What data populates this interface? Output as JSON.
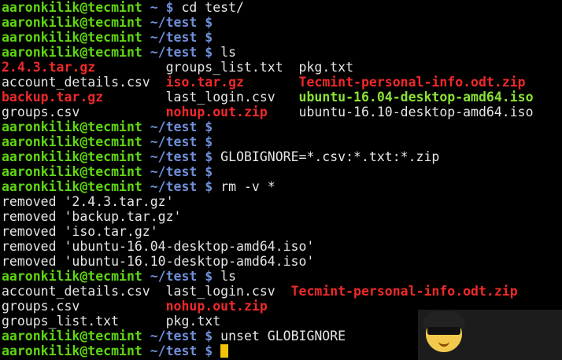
{
  "prompt": {
    "user": "aaronkilik@tecmint",
    "sep": " ",
    "dollar": " $"
  },
  "lines": [
    {
      "kind": "prompt",
      "path": "~",
      "cmd": "cd test/"
    },
    {
      "kind": "prompt",
      "path": "~/test",
      "cmd": ""
    },
    {
      "kind": "prompt",
      "path": "~/test",
      "cmd": ""
    },
    {
      "kind": "prompt",
      "path": "~/test",
      "cmd": "ls"
    },
    {
      "kind": "files",
      "cols": [
        {
          "name": "2.4.3.tar.gz",
          "style": "red"
        },
        {
          "name": "groups_list.txt",
          "style": "plain"
        },
        {
          "name": "pkg.txt",
          "style": "plain"
        }
      ]
    },
    {
      "kind": "files",
      "cols": [
        {
          "name": "account_details.csv",
          "style": "plain"
        },
        {
          "name": "iso.tar.gz",
          "style": "red"
        },
        {
          "name": "Tecmint-personal-info.odt.zip",
          "style": "red"
        }
      ]
    },
    {
      "kind": "files",
      "cols": [
        {
          "name": "backup.tar.gz",
          "style": "red"
        },
        {
          "name": "last_login.csv",
          "style": "plain"
        },
        {
          "name": "ubuntu-16.04-desktop-amd64.iso",
          "style": "green"
        }
      ]
    },
    {
      "kind": "files",
      "cols": [
        {
          "name": "groups.csv",
          "style": "plain"
        },
        {
          "name": "nohup.out.zip",
          "style": "red"
        },
        {
          "name": "ubuntu-16.10-desktop-amd64.iso",
          "style": "plain"
        }
      ]
    },
    {
      "kind": "prompt",
      "path": "~/test",
      "cmd": ""
    },
    {
      "kind": "prompt",
      "path": "~/test",
      "cmd": ""
    },
    {
      "kind": "prompt",
      "path": "~/test",
      "cmd": "GLOBIGNORE=*.csv:*.txt:*.zip"
    },
    {
      "kind": "prompt",
      "path": "~/test",
      "cmd": ""
    },
    {
      "kind": "prompt",
      "path": "~/test",
      "cmd": "rm -v *"
    },
    {
      "kind": "output",
      "text": "removed '2.4.3.tar.gz'"
    },
    {
      "kind": "output",
      "text": "removed 'backup.tar.gz'"
    },
    {
      "kind": "output",
      "text": "removed 'iso.tar.gz'"
    },
    {
      "kind": "output",
      "text": "removed 'ubuntu-16.04-desktop-amd64.iso'"
    },
    {
      "kind": "output",
      "text": "removed 'ubuntu-16.10-desktop-amd64.iso'"
    },
    {
      "kind": "prompt",
      "path": "~/test",
      "cmd": "ls"
    },
    {
      "kind": "files2",
      "cols": [
        {
          "name": "account_details.csv",
          "style": "plain"
        },
        {
          "name": "last_login.csv",
          "style": "plain"
        },
        {
          "name": "Tecmint-personal-info.odt.zip",
          "style": "red"
        }
      ]
    },
    {
      "kind": "files2",
      "cols": [
        {
          "name": "groups.csv",
          "style": "plain"
        },
        {
          "name": "nohup.out.zip",
          "style": "red"
        },
        {
          "name": "",
          "style": "plain"
        }
      ]
    },
    {
      "kind": "files2",
      "cols": [
        {
          "name": "groups_list.txt",
          "style": "plain"
        },
        {
          "name": "pkg.txt",
          "style": "plain"
        },
        {
          "name": "",
          "style": "plain"
        }
      ]
    },
    {
      "kind": "prompt",
      "path": "~/test",
      "cmd": "unset GLOBIGNORE"
    },
    {
      "kind": "prompt",
      "path": "~/test",
      "cmd": "",
      "cursor": true
    }
  ],
  "colors": {
    "background": "#000000",
    "user": "#5fd712",
    "path": "#6f8fd8",
    "text": "#e6e6e6",
    "archive_red": "#ef2929",
    "iso_green": "#8ae234",
    "cursor": "#f5c20a"
  },
  "icons": {
    "avatar": "avatar-icon"
  }
}
